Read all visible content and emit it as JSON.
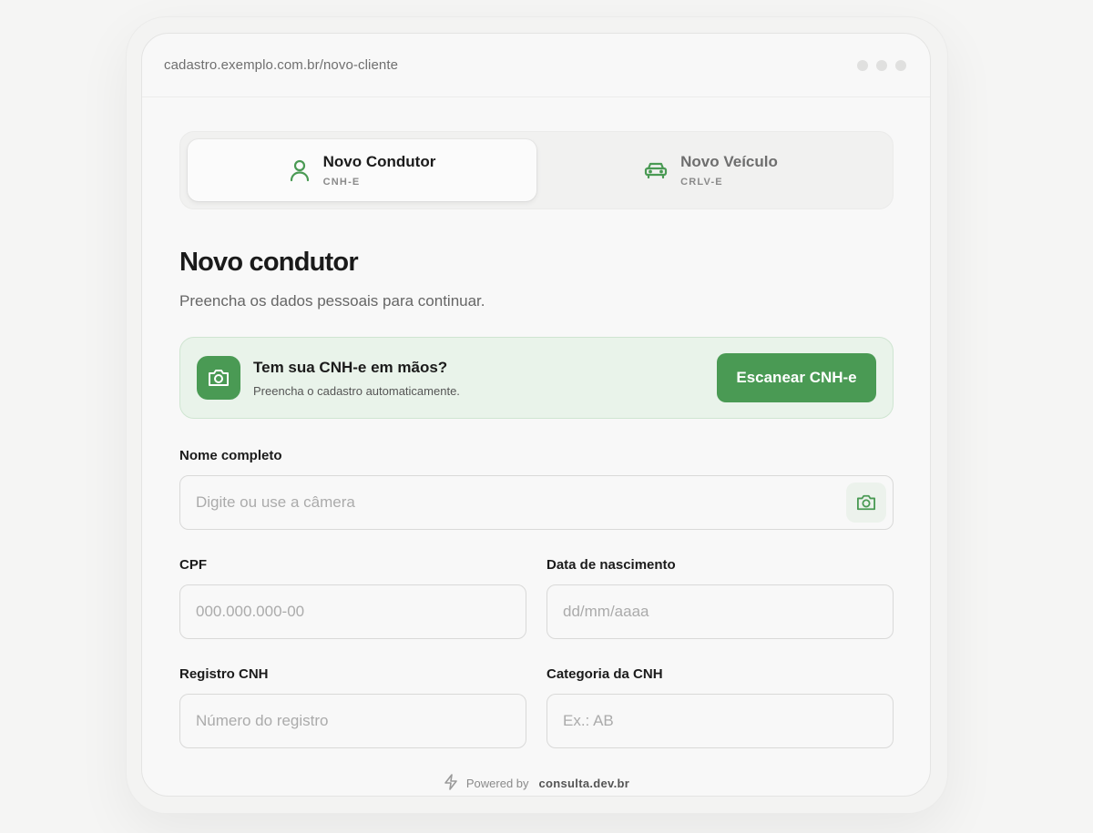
{
  "browser": {
    "url": "cadastro.exemplo.com.br/novo-cliente"
  },
  "tabs": [
    {
      "title": "Novo Condutor",
      "subtitle": "CNH-E",
      "icon": "user-icon",
      "active": true
    },
    {
      "title": "Novo Veículo",
      "subtitle": "CRLV-E",
      "icon": "car-icon",
      "active": false
    }
  ],
  "page": {
    "title": "Novo condutor",
    "subtitle": "Preencha os dados pessoais para continuar."
  },
  "scan_banner": {
    "title": "Tem sua CNH-e em mãos?",
    "subtitle": "Preencha o cadastro automaticamente.",
    "button_label": "Escanear CNH-e",
    "icon": "camera-icon"
  },
  "form": {
    "full_name": {
      "label": "Nome completo",
      "placeholder": "Digite ou use a câmera",
      "value": ""
    },
    "cpf": {
      "label": "CPF",
      "placeholder": "000.000.000-00",
      "value": ""
    },
    "birth_date": {
      "label": "Data de nascimento",
      "placeholder": "dd/mm/aaaa",
      "value": ""
    },
    "cnh_registry": {
      "label": "Registro CNH",
      "placeholder": "Número do registro",
      "value": ""
    },
    "cnh_category": {
      "label": "Categoria da CNH",
      "placeholder": "Ex.: AB",
      "value": ""
    }
  },
  "footer": {
    "powered_by": "Powered by",
    "brand": "consulta.dev.br",
    "icon": "lightning-icon"
  },
  "colors": {
    "accent": "#4a9a54",
    "banner_bg": "#e9f3ea"
  }
}
